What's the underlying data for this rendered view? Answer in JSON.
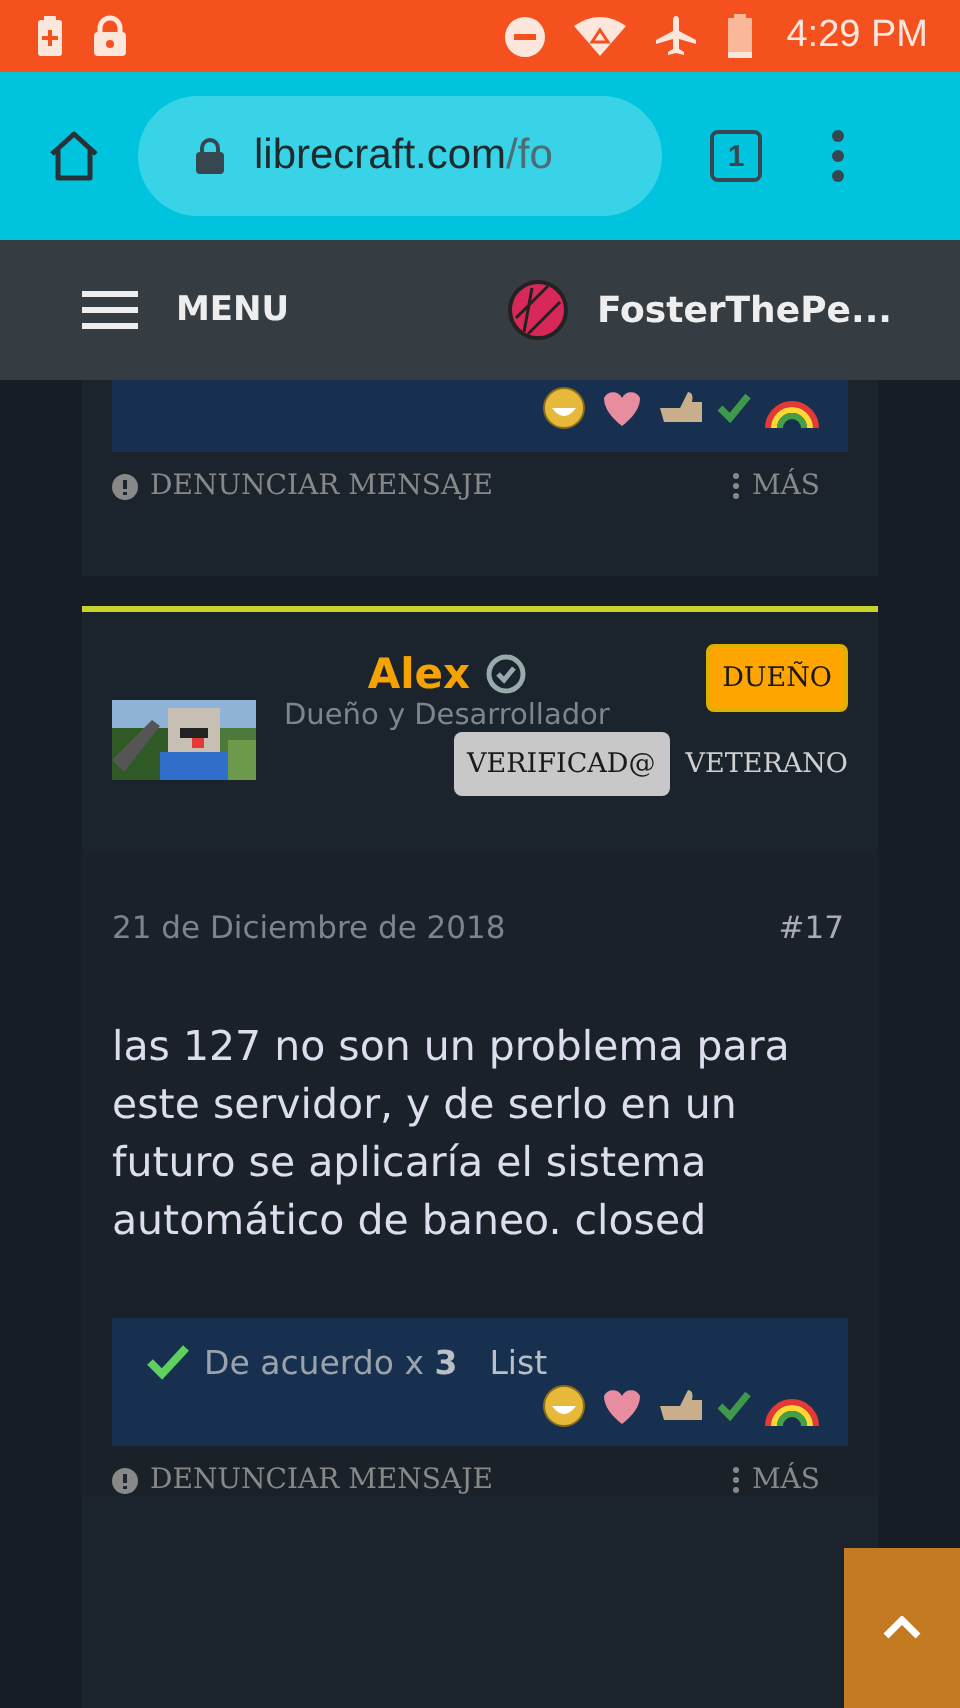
{
  "status_bar": {
    "time": "4:29 PM"
  },
  "browser": {
    "url_host": "librecraft.com",
    "url_path": "/fo",
    "tab_count": "1"
  },
  "site_header": {
    "menu_label": "MENU",
    "username": "FosterThePe..."
  },
  "previous_post": {
    "actions": {
      "report": "DENUNCIAR MENSAJE",
      "more": "MÁS"
    }
  },
  "post": {
    "author": {
      "name": "Alex",
      "verified": true,
      "title": "Dueño y Desarrollador",
      "badges": [
        {
          "label": "DUEÑO",
          "kind": "owner"
        },
        {
          "label": "VERIFICAD@",
          "kind": "verified"
        },
        {
          "label": "VETERANO",
          "kind": "plain"
        }
      ]
    },
    "date": "21 de Diciembre de 2018",
    "number": "#17",
    "message": "las 127 no son un problema para este servidor, y de serlo en un futuro se aplicaría el sistema automático de baneo. closed",
    "reactions_summary": "De acuerdo x **3**",
    "reactions_link": "List",
    "actions": {
      "report": "DENUNCIAR MENSAJE",
      "more": "MÁS"
    }
  }
}
